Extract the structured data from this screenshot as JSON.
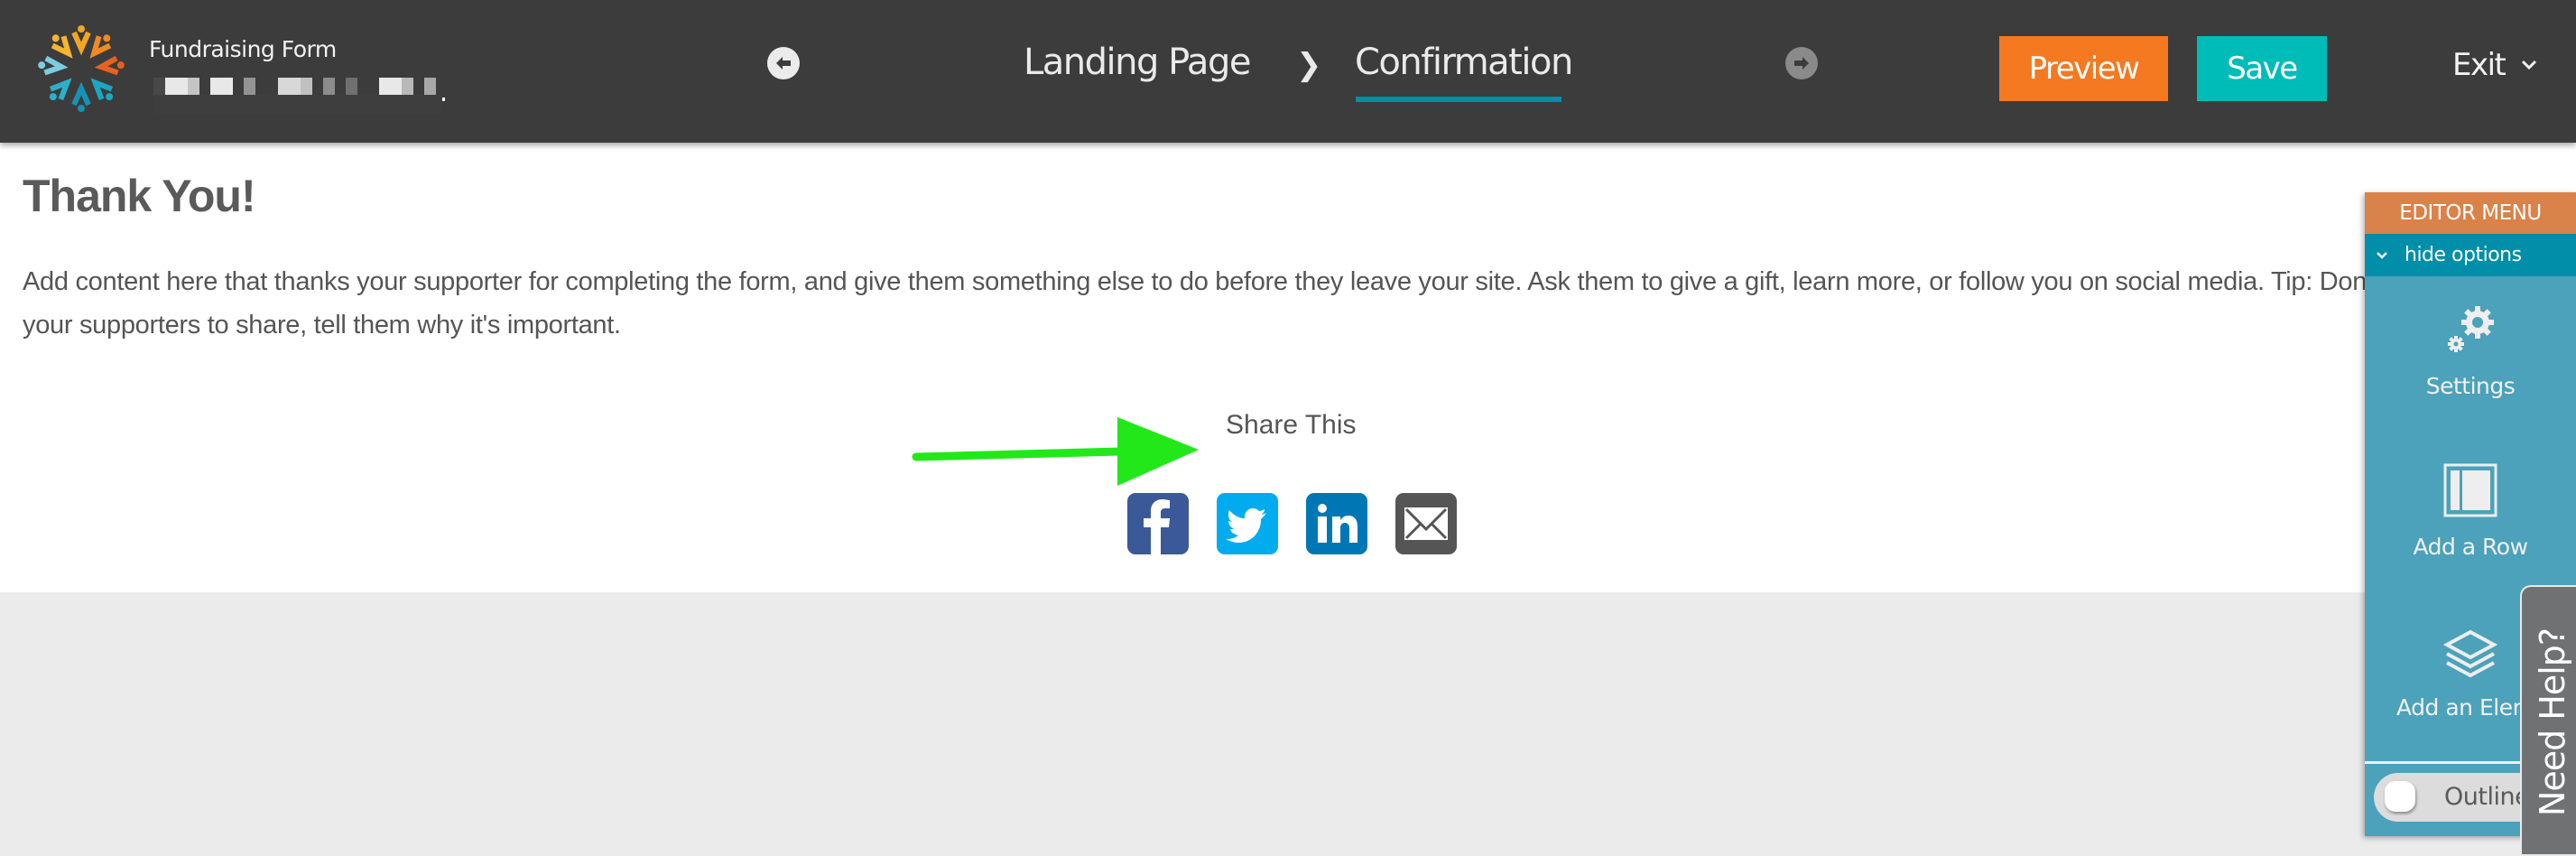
{
  "header": {
    "app_title": "Fundraising Form",
    "subtitle_redacted": true,
    "logo": "organization-logo",
    "back_icon": "arrow-left-circle-icon",
    "forward_icon": "arrow-right-circle-icon",
    "steps": [
      {
        "label": "Landing Page",
        "active": false
      },
      {
        "label": "Confirmation",
        "active": true
      }
    ],
    "step_separator": "❯",
    "preview_label": "Preview",
    "save_label": "Save",
    "exit_label": "Exit",
    "colors": {
      "preview": "#f47920",
      "save": "#00bcb8",
      "active_underline": "#008ea8"
    }
  },
  "content": {
    "heading": "Thank You!",
    "paragraph": "Add content here that thanks your supporter for completing the form, and give them something else to do before they leave your site. Ask them to give a gift, learn more, or follow you on social media. Tip: Don't just tell your supporters to share, tell them why it's important.",
    "share": {
      "label": "Share This",
      "icons": [
        {
          "name": "facebook-icon",
          "color": "#3b5998"
        },
        {
          "name": "twitter-icon",
          "color": "#00acee"
        },
        {
          "name": "linkedin-icon",
          "color": "#0077b5"
        },
        {
          "name": "email-icon",
          "color": "#555555"
        }
      ]
    },
    "annotation": "green-arrow"
  },
  "editor_menu": {
    "title": "EDITOR MENU",
    "hide_options": "hide options",
    "items": [
      {
        "label": "Settings",
        "icon": "gears-icon"
      },
      {
        "label": "Add a Row",
        "icon": "row-layout-icon"
      },
      {
        "label": "Add an Element",
        "icon": "layers-icon"
      }
    ],
    "outline_toggle": {
      "label": "Outline",
      "on": false
    },
    "colors": {
      "header": "#d9824a",
      "hide_bar": "#008ea8",
      "body": "#4ba2ba"
    }
  },
  "help_tab": {
    "label": "Need Help?"
  }
}
